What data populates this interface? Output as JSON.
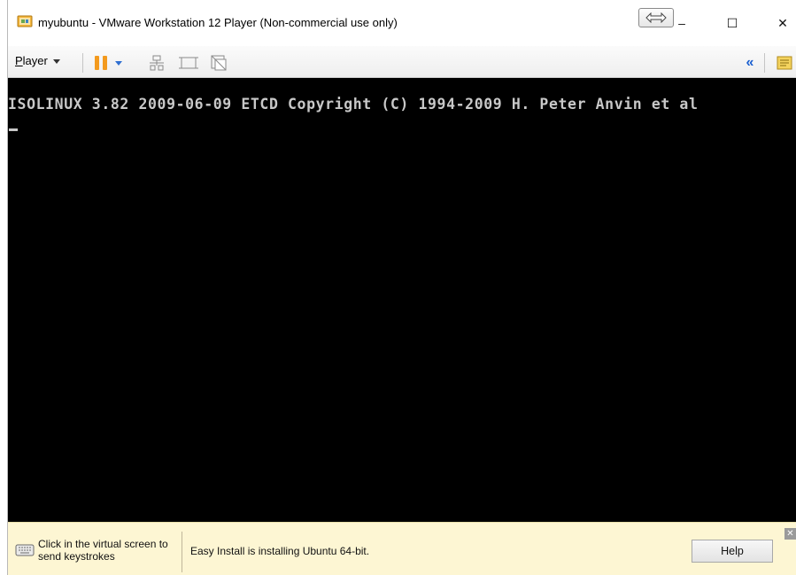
{
  "window": {
    "title": "myubuntu - VMware Workstation 12 Player (Non-commercial use only)",
    "controls": {
      "minimize": "–",
      "maximize": "☐",
      "close": "✕"
    }
  },
  "toolbar": {
    "player_menu_mnemonic": "P",
    "player_menu_rest": "layer",
    "collapse_glyph": "«",
    "icons": [
      "pause-icon",
      "send-ctrl-alt-del-icon",
      "fit-guest-icon",
      "unity-icon",
      "collapse-icon",
      "message-log-icon"
    ]
  },
  "console": {
    "line1": "ISOLINUX 3.82 2009-06-09 ETCD Copyright (C) 1994-2009 H. Peter Anvin et al"
  },
  "statusbar": {
    "hint": "Click in the virtual screen to send keystrokes",
    "message": "Easy Install is installing Ubuntu 64-bit.",
    "help_label": "Help",
    "dismiss_glyph": "✕"
  },
  "colors": {
    "pause_accent": "#f39a1e",
    "console_bg": "#000000",
    "console_text": "#c8c8c8",
    "statusbar_bg": "#fdf6d3",
    "link_blue": "#1a5fd0"
  }
}
